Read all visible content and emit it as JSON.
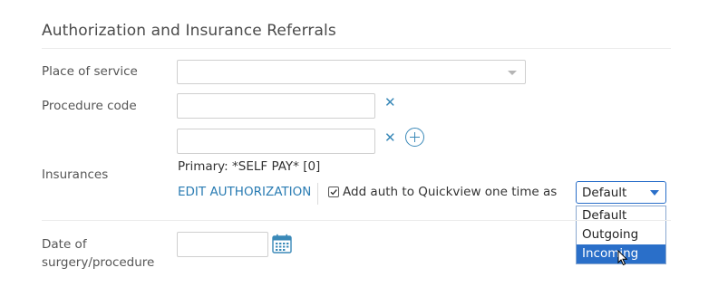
{
  "section": {
    "title": "Authorization and Insurance Referrals"
  },
  "place_of_service": {
    "label": "Place of service",
    "value": ""
  },
  "procedure_code": {
    "label": "Procedure code",
    "value_1": "",
    "value_2": ""
  },
  "insurances": {
    "label": "Insurances",
    "primary": "Primary: *SELF PAY* [0]",
    "edit_link": "EDIT AUTHORIZATION",
    "checkbox_checked": true,
    "checkbox_label": "Add auth to Quickview one time as",
    "dropdown_value": "Default",
    "dropdown_options": [
      "Default",
      "Outgoing",
      "Incoming"
    ],
    "highlighted_option": "Incoming"
  },
  "date_of_surgery": {
    "label_line1": "Date of",
    "label_line2": "surgery/procedure",
    "value": ""
  },
  "colors": {
    "accent": "#3a89b8",
    "link": "#2a7cb3",
    "dropdown_highlight": "#2a6fc9"
  },
  "icons": [
    "chevron-down-icon",
    "close-icon",
    "add-circle-icon",
    "checkbox-checked-icon",
    "calendar-icon",
    "mouse-cursor-icon"
  ]
}
